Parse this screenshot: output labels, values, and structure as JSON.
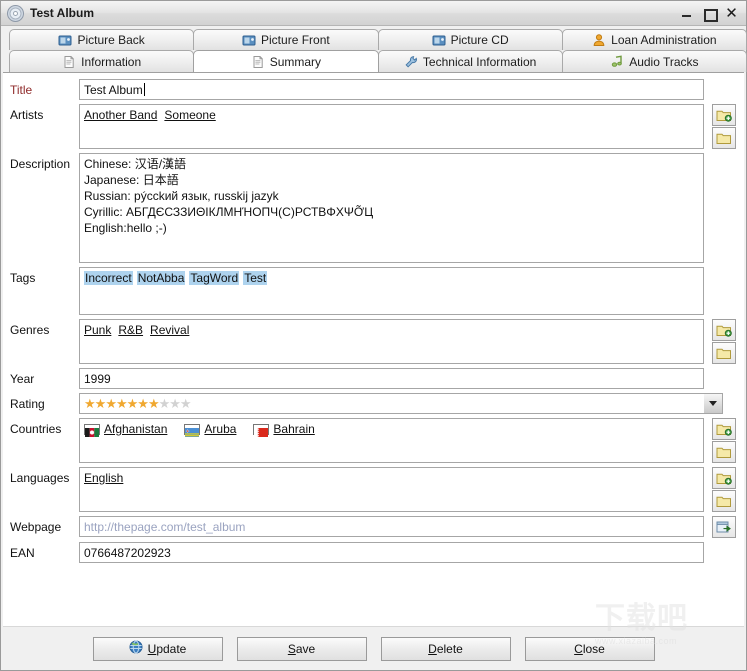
{
  "window": {
    "title": "Test Album",
    "icon": "cd-disc-icon",
    "controls": {
      "minimize": "–",
      "maximize": "□",
      "close": "✕"
    }
  },
  "tabs": {
    "row1": [
      {
        "label": "Picture Back",
        "icon": "picture-icon",
        "active": false
      },
      {
        "label": "Picture Front",
        "icon": "picture-icon",
        "active": false
      },
      {
        "label": "Picture CD",
        "icon": "picture-icon",
        "active": false
      },
      {
        "label": "Loan Administration",
        "icon": "person-icon",
        "active": false
      }
    ],
    "row2": [
      {
        "label": "Information",
        "icon": "document-icon",
        "active": false
      },
      {
        "label": "Summary",
        "icon": "document-icon",
        "active": true
      },
      {
        "label": "Technical Information",
        "icon": "wrench-icon",
        "active": false
      },
      {
        "label": "Audio Tracks",
        "icon": "music-note-icon",
        "active": false
      }
    ]
  },
  "form": {
    "title": {
      "label": "Title",
      "value": "Test Album",
      "required": true
    },
    "artists": {
      "label": "Artists",
      "items": [
        "Another Band",
        "Someone"
      ]
    },
    "description": {
      "label": "Description",
      "lines": [
        "Chinese: 汉语/漢語",
        "Japanese: 日本語",
        "Russian: pýcckий язык, russkij jazyk",
        "Cyrillic: АБГДЄСЗЗИΘІКЛМНΉОПЧ(С)РСТВΦХΨỠЦ",
        "English:hello ;-)"
      ]
    },
    "tags": {
      "label": "Tags",
      "items": [
        "Incorrect",
        "NotAbba",
        "TagWord",
        "Test"
      ]
    },
    "genres": {
      "label": "Genres",
      "items": [
        "Punk",
        "R&B",
        "Revival"
      ]
    },
    "year": {
      "label": "Year",
      "value": "1999"
    },
    "rating": {
      "label": "Rating",
      "filled": 7,
      "total": 10,
      "star_on_color": "#f0a830",
      "star_off_color": "#d2d2d2"
    },
    "countries": {
      "label": "Countries",
      "items": [
        {
          "name": "Afghanistan",
          "flag": "afghanistan-flag"
        },
        {
          "name": "Aruba",
          "flag": "aruba-flag"
        },
        {
          "name": "Bahrain",
          "flag": "bahrain-flag"
        }
      ]
    },
    "languages": {
      "label": "Languages",
      "items": [
        "English"
      ]
    },
    "webpage": {
      "label": "Webpage",
      "value": "",
      "placeholder": "http://thepage.com/test_album"
    },
    "ean": {
      "label": "EAN",
      "value": "0766487202923"
    }
  },
  "side_buttons": {
    "add": "add-folder-icon",
    "browse": "folder-icon",
    "goto": "open-webpage-icon"
  },
  "buttons": [
    {
      "label": "Update",
      "mnemonic": "U",
      "icon": "globe-icon"
    },
    {
      "label": "Save",
      "mnemonic": "S",
      "icon": ""
    },
    {
      "label": "Delete",
      "mnemonic": "D",
      "icon": ""
    },
    {
      "label": "Close",
      "mnemonic": "C",
      "icon": ""
    }
  ],
  "watermark": {
    "text": "下载吧",
    "sub": "www.xiazaiba.com"
  }
}
